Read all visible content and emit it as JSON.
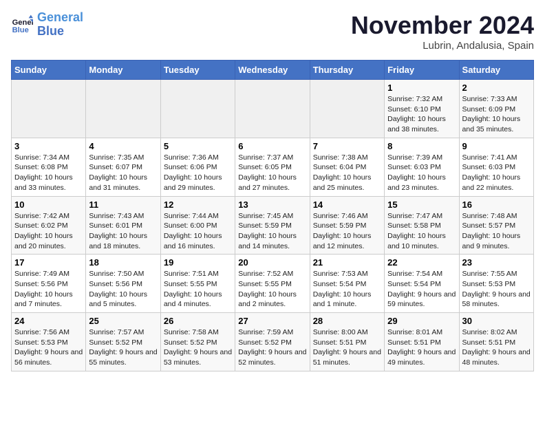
{
  "header": {
    "logo_line1": "General",
    "logo_line2": "Blue",
    "month": "November 2024",
    "location": "Lubrin, Andalusia, Spain"
  },
  "weekdays": [
    "Sunday",
    "Monday",
    "Tuesday",
    "Wednesday",
    "Thursday",
    "Friday",
    "Saturday"
  ],
  "weeks": [
    [
      {
        "day": "",
        "sunrise": "",
        "sunset": "",
        "daylight": ""
      },
      {
        "day": "",
        "sunrise": "",
        "sunset": "",
        "daylight": ""
      },
      {
        "day": "",
        "sunrise": "",
        "sunset": "",
        "daylight": ""
      },
      {
        "day": "",
        "sunrise": "",
        "sunset": "",
        "daylight": ""
      },
      {
        "day": "",
        "sunrise": "",
        "sunset": "",
        "daylight": ""
      },
      {
        "day": "1",
        "sunrise": "Sunrise: 7:32 AM",
        "sunset": "Sunset: 6:10 PM",
        "daylight": "Daylight: 10 hours and 38 minutes."
      },
      {
        "day": "2",
        "sunrise": "Sunrise: 7:33 AM",
        "sunset": "Sunset: 6:09 PM",
        "daylight": "Daylight: 10 hours and 35 minutes."
      }
    ],
    [
      {
        "day": "3",
        "sunrise": "Sunrise: 7:34 AM",
        "sunset": "Sunset: 6:08 PM",
        "daylight": "Daylight: 10 hours and 33 minutes."
      },
      {
        "day": "4",
        "sunrise": "Sunrise: 7:35 AM",
        "sunset": "Sunset: 6:07 PM",
        "daylight": "Daylight: 10 hours and 31 minutes."
      },
      {
        "day": "5",
        "sunrise": "Sunrise: 7:36 AM",
        "sunset": "Sunset: 6:06 PM",
        "daylight": "Daylight: 10 hours and 29 minutes."
      },
      {
        "day": "6",
        "sunrise": "Sunrise: 7:37 AM",
        "sunset": "Sunset: 6:05 PM",
        "daylight": "Daylight: 10 hours and 27 minutes."
      },
      {
        "day": "7",
        "sunrise": "Sunrise: 7:38 AM",
        "sunset": "Sunset: 6:04 PM",
        "daylight": "Daylight: 10 hours and 25 minutes."
      },
      {
        "day": "8",
        "sunrise": "Sunrise: 7:39 AM",
        "sunset": "Sunset: 6:03 PM",
        "daylight": "Daylight: 10 hours and 23 minutes."
      },
      {
        "day": "9",
        "sunrise": "Sunrise: 7:41 AM",
        "sunset": "Sunset: 6:03 PM",
        "daylight": "Daylight: 10 hours and 22 minutes."
      }
    ],
    [
      {
        "day": "10",
        "sunrise": "Sunrise: 7:42 AM",
        "sunset": "Sunset: 6:02 PM",
        "daylight": "Daylight: 10 hours and 20 minutes."
      },
      {
        "day": "11",
        "sunrise": "Sunrise: 7:43 AM",
        "sunset": "Sunset: 6:01 PM",
        "daylight": "Daylight: 10 hours and 18 minutes."
      },
      {
        "day": "12",
        "sunrise": "Sunrise: 7:44 AM",
        "sunset": "Sunset: 6:00 PM",
        "daylight": "Daylight: 10 hours and 16 minutes."
      },
      {
        "day": "13",
        "sunrise": "Sunrise: 7:45 AM",
        "sunset": "Sunset: 5:59 PM",
        "daylight": "Daylight: 10 hours and 14 minutes."
      },
      {
        "day": "14",
        "sunrise": "Sunrise: 7:46 AM",
        "sunset": "Sunset: 5:59 PM",
        "daylight": "Daylight: 10 hours and 12 minutes."
      },
      {
        "day": "15",
        "sunrise": "Sunrise: 7:47 AM",
        "sunset": "Sunset: 5:58 PM",
        "daylight": "Daylight: 10 hours and 10 minutes."
      },
      {
        "day": "16",
        "sunrise": "Sunrise: 7:48 AM",
        "sunset": "Sunset: 5:57 PM",
        "daylight": "Daylight: 10 hours and 9 minutes."
      }
    ],
    [
      {
        "day": "17",
        "sunrise": "Sunrise: 7:49 AM",
        "sunset": "Sunset: 5:56 PM",
        "daylight": "Daylight: 10 hours and 7 minutes."
      },
      {
        "day": "18",
        "sunrise": "Sunrise: 7:50 AM",
        "sunset": "Sunset: 5:56 PM",
        "daylight": "Daylight: 10 hours and 5 minutes."
      },
      {
        "day": "19",
        "sunrise": "Sunrise: 7:51 AM",
        "sunset": "Sunset: 5:55 PM",
        "daylight": "Daylight: 10 hours and 4 minutes."
      },
      {
        "day": "20",
        "sunrise": "Sunrise: 7:52 AM",
        "sunset": "Sunset: 5:55 PM",
        "daylight": "Daylight: 10 hours and 2 minutes."
      },
      {
        "day": "21",
        "sunrise": "Sunrise: 7:53 AM",
        "sunset": "Sunset: 5:54 PM",
        "daylight": "Daylight: 10 hours and 1 minute."
      },
      {
        "day": "22",
        "sunrise": "Sunrise: 7:54 AM",
        "sunset": "Sunset: 5:54 PM",
        "daylight": "Daylight: 9 hours and 59 minutes."
      },
      {
        "day": "23",
        "sunrise": "Sunrise: 7:55 AM",
        "sunset": "Sunset: 5:53 PM",
        "daylight": "Daylight: 9 hours and 58 minutes."
      }
    ],
    [
      {
        "day": "24",
        "sunrise": "Sunrise: 7:56 AM",
        "sunset": "Sunset: 5:53 PM",
        "daylight": "Daylight: 9 hours and 56 minutes."
      },
      {
        "day": "25",
        "sunrise": "Sunrise: 7:57 AM",
        "sunset": "Sunset: 5:52 PM",
        "daylight": "Daylight: 9 hours and 55 minutes."
      },
      {
        "day": "26",
        "sunrise": "Sunrise: 7:58 AM",
        "sunset": "Sunset: 5:52 PM",
        "daylight": "Daylight: 9 hours and 53 minutes."
      },
      {
        "day": "27",
        "sunrise": "Sunrise: 7:59 AM",
        "sunset": "Sunset: 5:52 PM",
        "daylight": "Daylight: 9 hours and 52 minutes."
      },
      {
        "day": "28",
        "sunrise": "Sunrise: 8:00 AM",
        "sunset": "Sunset: 5:51 PM",
        "daylight": "Daylight: 9 hours and 51 minutes."
      },
      {
        "day": "29",
        "sunrise": "Sunrise: 8:01 AM",
        "sunset": "Sunset: 5:51 PM",
        "daylight": "Daylight: 9 hours and 49 minutes."
      },
      {
        "day": "30",
        "sunrise": "Sunrise: 8:02 AM",
        "sunset": "Sunset: 5:51 PM",
        "daylight": "Daylight: 9 hours and 48 minutes."
      }
    ]
  ]
}
